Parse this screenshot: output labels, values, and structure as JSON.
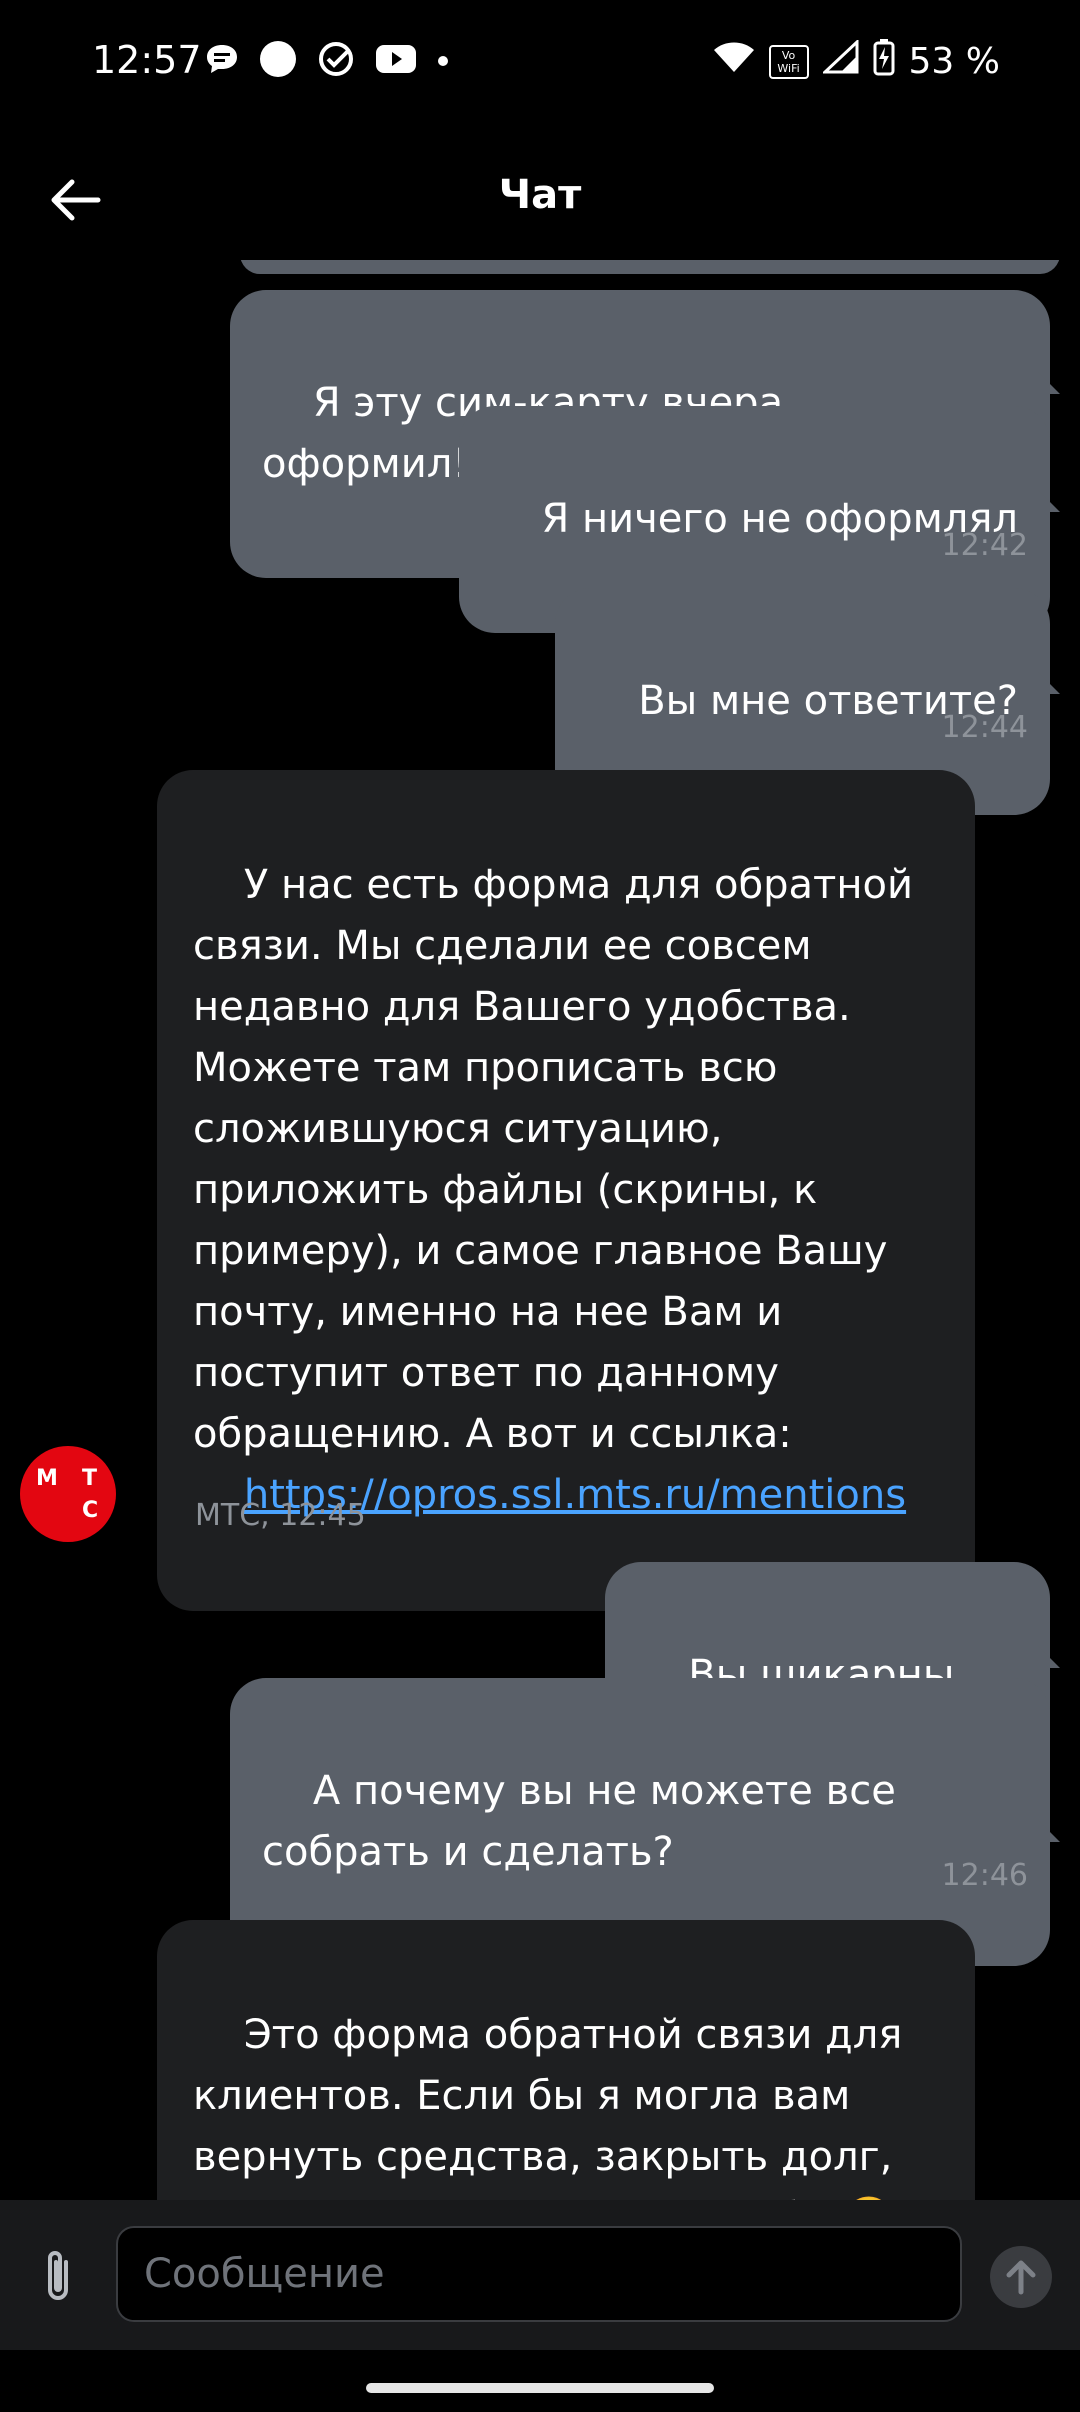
{
  "status_bar": {
    "time": "12:57",
    "battery": "53 %",
    "icons_left": [
      "chat-bubble-icon",
      "circle-icon",
      "check-circle-icon",
      "youtube-icon",
      "dot-icon"
    ],
    "icons_right": [
      "wifi-icon",
      "vowifi-icon",
      "signal-icon",
      "battery-charging-icon"
    ],
    "vowifi_text": "Vo WiFi"
  },
  "header": {
    "title": "Чат"
  },
  "messages": [
    {
      "dir": "out",
      "text": "Я эту сим-карту вчера оформил!!!!"
    },
    {
      "dir": "out",
      "text": "Я ничего не оформлял"
    },
    {
      "dir": "out",
      "text": "Вы мне ответите?"
    },
    {
      "dir": "in",
      "text": "У нас есть форма для обратной связи. Мы сделали ее совсем недавно для Вашего удобства. Можете там прописать всю сложившуюся ситуацию, приложить файлы (скрины, к примеру), и самое главное Вашу почту, именно на нее Вам и поступит ответ по данному обращению. А вот и ссылка:",
      "link": "https://opros.ssl.mts.ru/mentions"
    },
    {
      "dir": "out",
      "text": "Вы шикарны....."
    },
    {
      "dir": "out",
      "text": "А почему вы не можете все собрать и сделать?"
    },
    {
      "dir": "in",
      "text": "Это форма обратной связи для клиентов. Если бы я могла вам вернуть средства, закрыть долг, то с радостью это сделала бы 🥺"
    }
  ],
  "timestamps": [
    "12:42",
    "12:44",
    "МТС, 12:45",
    "12:46"
  ],
  "avatar": {
    "letters": [
      "М",
      "Т",
      "С"
    ],
    "color": "#e30611"
  },
  "input": {
    "placeholder": "Сообщение"
  },
  "colors": {
    "outgoing": "#5a6069",
    "incoming": "#1e1f21",
    "link": "#4aa3ff",
    "background": "#000000"
  }
}
